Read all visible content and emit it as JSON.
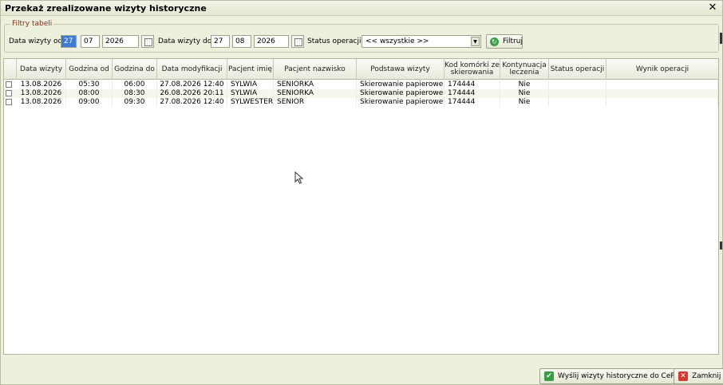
{
  "window": {
    "title": "Przekaż zrealizowane wizyty historyczne",
    "close_glyph": "✕"
  },
  "filters": {
    "legend": "Filtry tabeli",
    "from_label": "Data wizyty od",
    "from_day": "27",
    "from_month": "07",
    "from_year": "2026",
    "to_label": "Data wizyty do",
    "to_day": "27",
    "to_month": "08",
    "to_year": "2026",
    "status_label": "Status operacji",
    "status_value": "<< wszystkie >>",
    "filter_button": "Filtruj",
    "calendar_icon": "calendar-icon",
    "refresh_icon": "refresh-icon"
  },
  "table": {
    "columns": [
      "Data wizyty",
      "Godzina od",
      "Godzina do",
      "Data modyfikacji",
      "Pacjent imię",
      "Pacjent nazwisko",
      "Podstawa wizyty",
      "Kod komórki ze skierowania",
      "Kontynuacja leczenia",
      "Status operacji",
      "Wynik operacji"
    ],
    "rows": [
      [
        "13.08.2026",
        "05:30",
        "06:00",
        "27.08.2026 12:40",
        "SYLWIA",
        "SENIORKA",
        "Skierowanie papierowe",
        "174444",
        "Nie",
        "",
        ""
      ],
      [
        "13.08.2026",
        "08:00",
        "08:30",
        "26.08.2026 20:11",
        "SYLWIA",
        "SENIORKA",
        "Skierowanie papierowe",
        "174444",
        "Nie",
        "",
        ""
      ],
      [
        "13.08.2026",
        "09:00",
        "09:30",
        "27.08.2026 12:40",
        "SYLWESTER",
        "SENIOR",
        "Skierowanie papierowe",
        "174444",
        "Nie",
        "",
        ""
      ]
    ]
  },
  "footer": {
    "send_button": "Wyślij wizyty historyczne do CeR",
    "send_icon": "checkmark-icon",
    "close_button": "Zamknij",
    "close_icon": "close-icon"
  },
  "colors": {
    "window_bg": "#eef0de",
    "legend_text": "#8a2a10",
    "selected_input": "#3d7bd6",
    "accent_green": "#3a9c46",
    "accent_red": "#d23a2e"
  }
}
